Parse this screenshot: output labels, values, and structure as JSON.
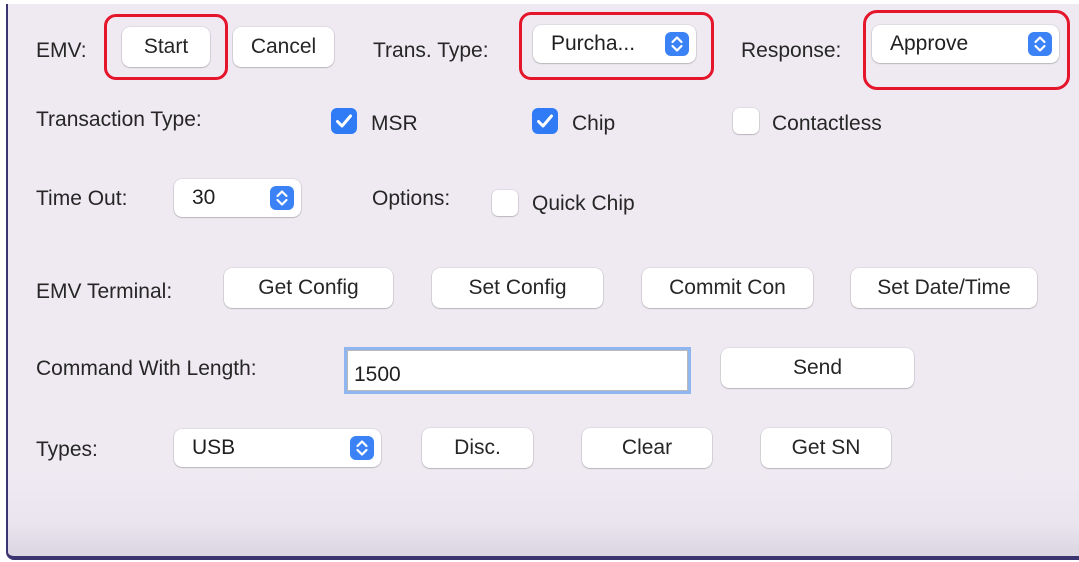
{
  "emv": {
    "label": "EMV:",
    "start_label": "Start",
    "cancel_label": "Cancel"
  },
  "trans_type": {
    "label": "Trans. Type:",
    "selected": "Purcha..."
  },
  "response": {
    "label": "Response:",
    "selected": "Approve"
  },
  "transaction_type": {
    "label": "Transaction Type:",
    "options": [
      {
        "label": "MSR",
        "checked": true
      },
      {
        "label": "Chip",
        "checked": true
      },
      {
        "label": "Contactless",
        "checked": false
      }
    ]
  },
  "time_out": {
    "label": "Time Out:",
    "selected": "30"
  },
  "options": {
    "label": "Options:",
    "quick_chip_label": "Quick Chip",
    "quick_chip_checked": false
  },
  "emv_terminal": {
    "label": "EMV Terminal:",
    "buttons": [
      "Get Config",
      "Set Config",
      "Commit Con",
      "Set Date/Time"
    ]
  },
  "command": {
    "label": "Command With Length:",
    "value": "1500",
    "send_label": "Send"
  },
  "types": {
    "label": "Types:",
    "selected": "USB",
    "disc_label": "Disc.",
    "clear_label": "Clear",
    "get_sn_label": "Get SN"
  },
  "colors": {
    "accent": "#3b82f6",
    "highlight": "#e5152b",
    "window_bg": "#efeaf2",
    "frame": "#3a3570"
  },
  "icons": {
    "select_chevron": "chevron-up-down-icon",
    "checkbox_check": "checkmark-icon"
  }
}
